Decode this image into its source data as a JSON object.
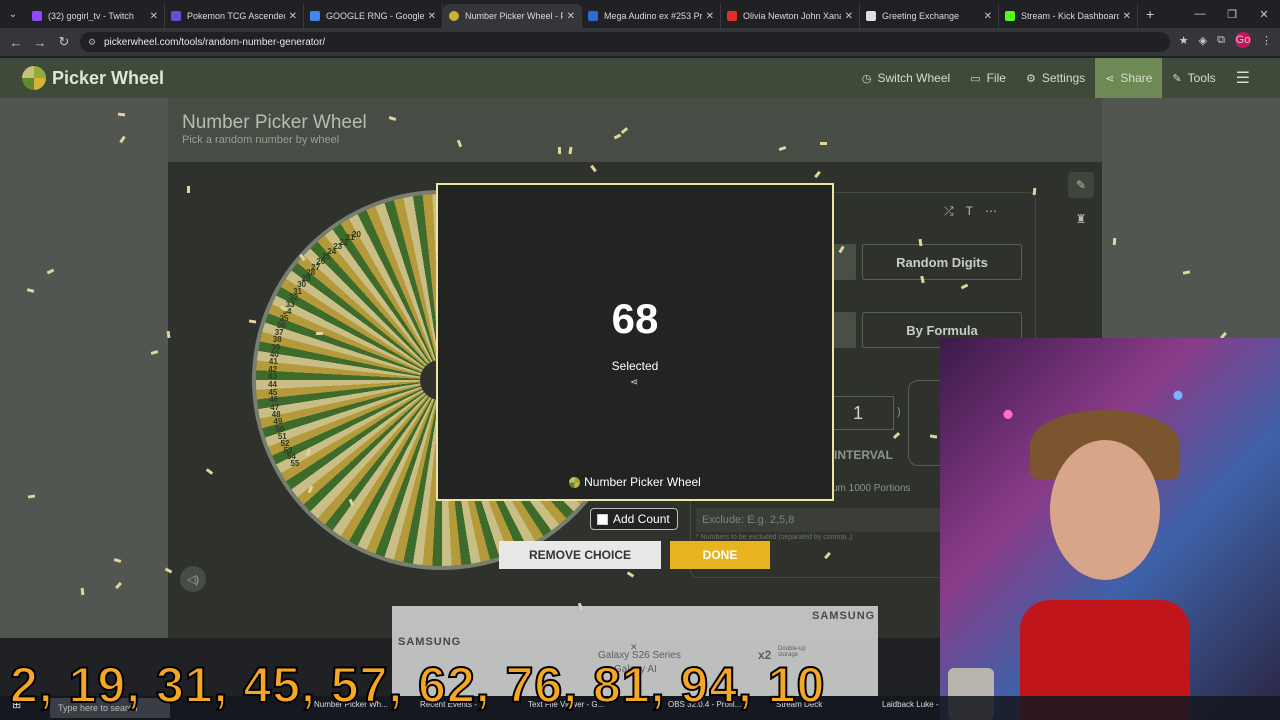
{
  "browser": {
    "tabs": [
      {
        "label": "(32) gogirl_tv - Twitch",
        "color": "#9146ff"
      },
      {
        "label": "Pokemon TCG Ascended I",
        "color": "#6c4bd8"
      },
      {
        "label": "GOOGLE RNG - Google S",
        "color": "#4285f4"
      },
      {
        "label": "Number Picker Wheel - P",
        "color": "#c8b23c"
      },
      {
        "label": "Mega Audino ex #253 Pr",
        "color": "#2e6bd1"
      },
      {
        "label": "Olivia Newton John Xana",
        "color": "#e52d27"
      },
      {
        "label": "Greeting Exchange",
        "color": "#e0e0e0"
      },
      {
        "label": "Stream - Kick Dashboard",
        "color": "#53fc18"
      }
    ],
    "url": "pickerwheel.com/tools/random-number-generator/",
    "profile": "Go"
  },
  "site": {
    "logo": "Picker Wheel",
    "nav": [
      "Switch Wheel",
      "File",
      "Settings",
      "Share",
      "Tools"
    ],
    "title": "Number Picker Wheel",
    "subtitle": "Pick a random number by wheel"
  },
  "wheel": {
    "labels": [
      "55",
      "54",
      "53",
      "52",
      "51",
      "50",
      "49",
      "48",
      "47",
      "46",
      "45",
      "44",
      "43",
      "42",
      "41",
      "40",
      "39",
      "38",
      "37",
      "36",
      "35",
      "34",
      "33",
      "32",
      "31",
      "30",
      "29",
      "28",
      "27",
      "26",
      "25",
      "24",
      "23",
      "22",
      "21",
      "20"
    ]
  },
  "options": {
    "random_digits": "Random Digits",
    "by_formula": "By Formula",
    "interval_value": "1",
    "interval_label": "INTERVAL",
    "portions_note": "um 1000 Portions",
    "exclude_placeholder": "Exclude: E.g. 2,5,8",
    "exclude_note": "* Numbers to be excluded (separated by comma ,)"
  },
  "modal": {
    "result": "68",
    "status": "Selected",
    "footer": "Number Picker Wheel",
    "add_count": "Add Count",
    "remove": "REMOVE CHOICE",
    "done": "DONE"
  },
  "ad": {
    "brand1": "SAMSUNG",
    "brand2": "SAMSUNG",
    "product": "Galaxy S26 Series",
    "sub": "Galaxy AI",
    "badge": "x2",
    "storage": "Double-up storage"
  },
  "overlay": {
    "numbers": "2, 19, 31, 45, 57, 62, 76, 81, 94, 10"
  },
  "taskbar": {
    "search": "Type here to search",
    "items": [
      "Number Picker Wh...",
      "Recent Events - ...",
      "Text File Viewer - G...",
      "OBS 32.0.4 - Profil...",
      "Stream Deck",
      "Laidback Luke -"
    ]
  },
  "colors": {
    "accent_done": "#e7b420",
    "header_bg": "#3f4a3a",
    "share_bg": "#6d8a55",
    "overlay_text": "#f5a623"
  }
}
